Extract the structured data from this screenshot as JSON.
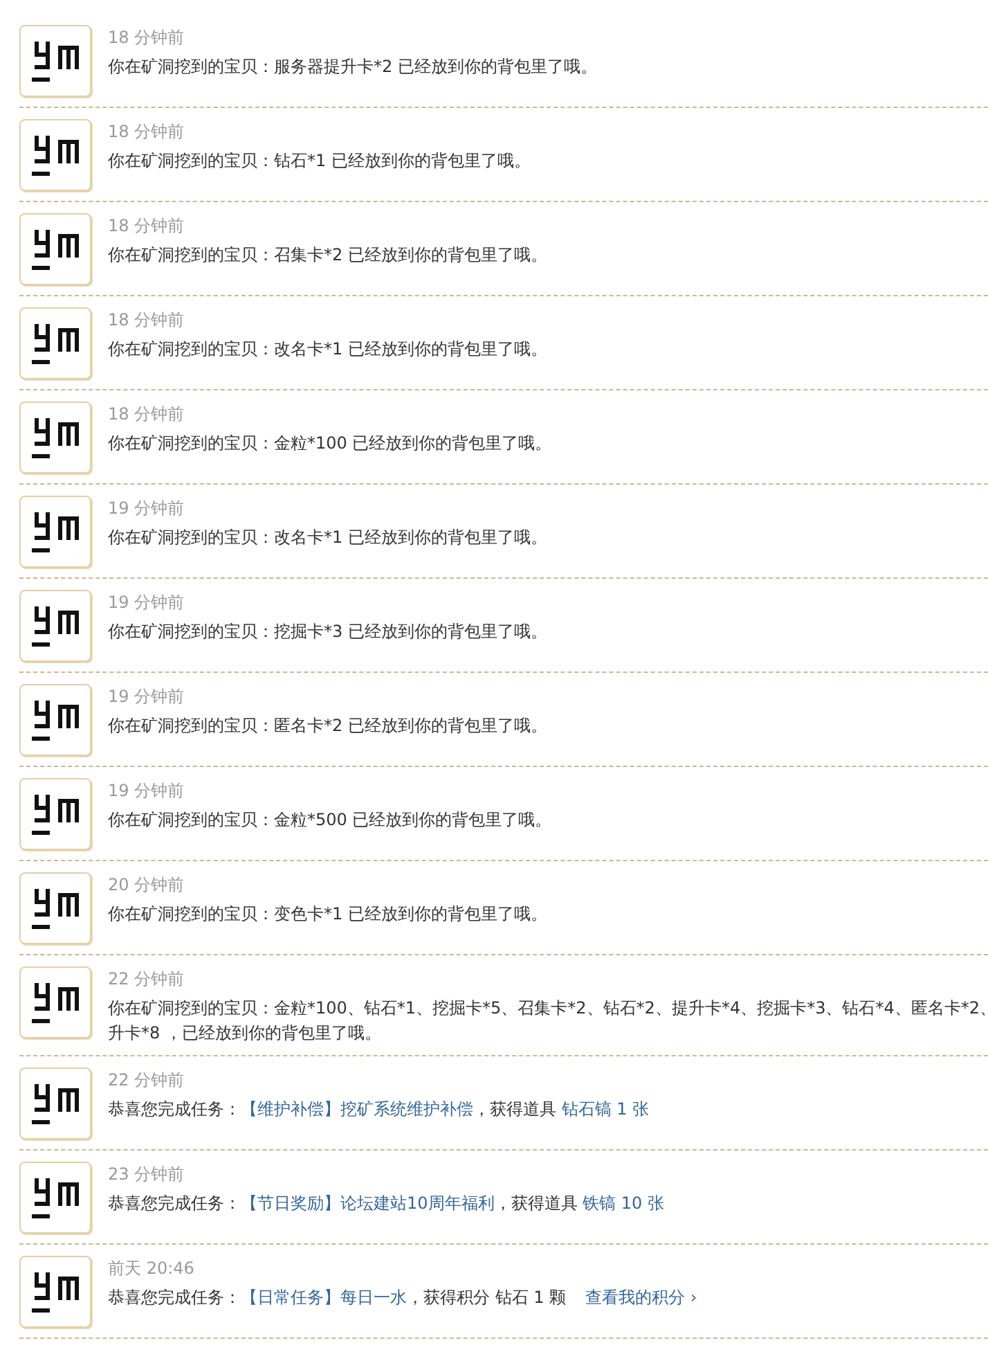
{
  "notices": [
    {
      "time": "18 分钟前",
      "kind": "loot",
      "lines": [
        "你在矿洞挖到的宝贝：服务器提升卡*2 已经放到你的背包里了哦。"
      ]
    },
    {
      "time": "18 分钟前",
      "kind": "loot",
      "lines": [
        "你在矿洞挖到的宝贝：钻石*1 已经放到你的背包里了哦。"
      ]
    },
    {
      "time": "18 分钟前",
      "kind": "loot",
      "lines": [
        "你在矿洞挖到的宝贝：召集卡*2 已经放到你的背包里了哦。"
      ]
    },
    {
      "time": "18 分钟前",
      "kind": "loot",
      "lines": [
        "你在矿洞挖到的宝贝：改名卡*1 已经放到你的背包里了哦。"
      ]
    },
    {
      "time": "18 分钟前",
      "kind": "loot",
      "lines": [
        "你在矿洞挖到的宝贝：金粒*100 已经放到你的背包里了哦。"
      ]
    },
    {
      "time": "19 分钟前",
      "kind": "loot",
      "lines": [
        "你在矿洞挖到的宝贝：改名卡*1 已经放到你的背包里了哦。"
      ]
    },
    {
      "time": "19 分钟前",
      "kind": "loot",
      "lines": [
        "你在矿洞挖到的宝贝：挖掘卡*3 已经放到你的背包里了哦。"
      ]
    },
    {
      "time": "19 分钟前",
      "kind": "loot",
      "lines": [
        "你在矿洞挖到的宝贝：匿名卡*2 已经放到你的背包里了哦。"
      ]
    },
    {
      "time": "19 分钟前",
      "kind": "loot",
      "lines": [
        "你在矿洞挖到的宝贝：金粒*500 已经放到你的背包里了哦。"
      ]
    },
    {
      "time": "20 分钟前",
      "kind": "loot",
      "lines": [
        "你在矿洞挖到的宝贝：变色卡*1 已经放到你的背包里了哦。"
      ]
    },
    {
      "time": "22 分钟前",
      "kind": "loot",
      "lines": [
        "你在矿洞挖到的宝贝：金粒*100、钻石*1、挖掘卡*5、召集卡*2、钻石*2、提升卡*4、挖掘卡*3、钻石*4、匿名卡*2、",
        "升卡*8 ，已经放到你的背包里了哦。"
      ]
    },
    {
      "time": "22 分钟前",
      "kind": "task",
      "prefix": "恭喜您完成任务：",
      "task": "【维护补偿】挖矿系统维护补偿",
      "rest": "，获得道具 ",
      "reward": "钻石镐 1 张"
    },
    {
      "time": "23 分钟前",
      "kind": "task",
      "prefix": "恭喜您完成任务：",
      "task": "【节日奖励】论坛建站10周年福利",
      "rest": "，获得道具 ",
      "reward": "铁镐 10 张"
    },
    {
      "time": "前天 20:46",
      "kind": "task",
      "prefix": "恭喜您完成任务：",
      "task": "【日常任务】每日一水",
      "rest": "，获得积分 钻石 1 颗",
      "link": "查看我的积分 ›"
    }
  ]
}
